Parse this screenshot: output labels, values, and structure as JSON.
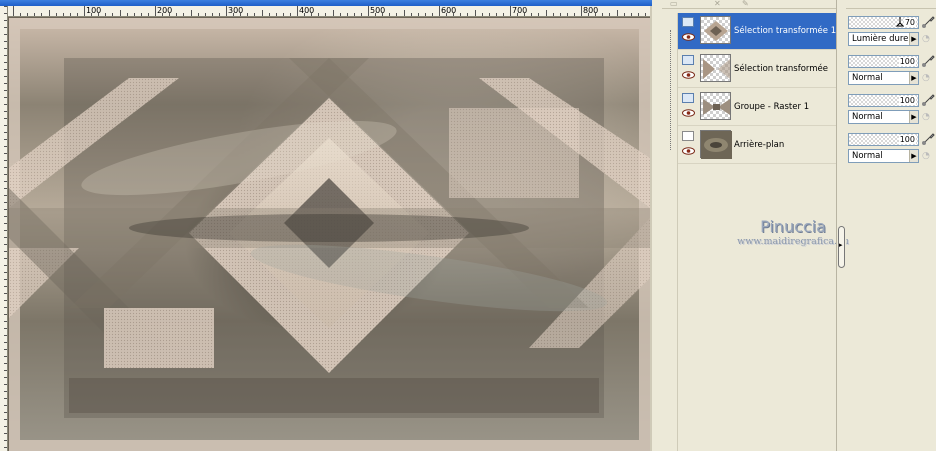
{
  "ruler": {
    "labels": [
      "100",
      "200",
      "300",
      "400",
      "500",
      "600",
      "700",
      "800"
    ]
  },
  "layers": [
    {
      "name": "Sélection transformée 1",
      "selected": true,
      "icon": "vector-layer-icon"
    },
    {
      "name": "Sélection transformée",
      "selected": false,
      "icon": "vector-layer-icon"
    },
    {
      "name": "Groupe - Raster 1",
      "selected": false,
      "icon": "group-layer-icon"
    },
    {
      "name": "Arrière-plan",
      "selected": false,
      "icon": "raster-layer-icon"
    }
  ],
  "properties": [
    {
      "opacity": "70",
      "blend_mode": "Lumière dure"
    },
    {
      "opacity": "100",
      "blend_mode": "Normal"
    },
    {
      "opacity": "100",
      "blend_mode": "Normal"
    },
    {
      "opacity": "100",
      "blend_mode": "Normal"
    }
  ],
  "watermark": {
    "name": "Pinuccia",
    "url": "www.maidiregrafica.eu"
  },
  "colors": {
    "selection": "#316ac5",
    "panel_bg": "#ece9d8"
  }
}
